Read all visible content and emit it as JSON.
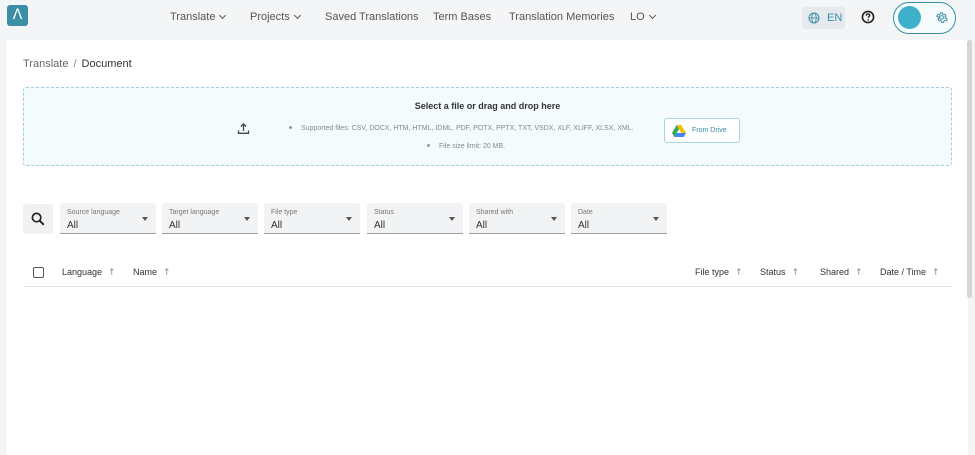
{
  "nav": {
    "logo": "Λ",
    "items": [
      {
        "label": "Translate",
        "dropdown": true
      },
      {
        "label": "Projects",
        "dropdown": true
      },
      {
        "label": "Saved Translations",
        "dropdown": false
      },
      {
        "label": "Term Bases",
        "dropdown": false
      },
      {
        "label": "Translation Memories",
        "dropdown": false
      },
      {
        "label": "LO",
        "dropdown": true
      }
    ],
    "language": "EN",
    "accent_color": "#3b8ea5"
  },
  "breadcrumb": {
    "parent": "Translate",
    "separator": "/",
    "current": "Document"
  },
  "upload": {
    "title": "Select a file or drag and drop here",
    "supported": "Supported files: CSV, DOCX, HTM, HTML, IDML, PDF, POTX, PPTX, TXT, VSDX, XLF, XLIFF, XLSX, XML.",
    "size_limit": "File size limit: 20 MB.",
    "drive_button": "From Drive"
  },
  "filters": [
    {
      "label": "Source language",
      "value": "All"
    },
    {
      "label": "Target language",
      "value": "All"
    },
    {
      "label": "File type",
      "value": "All"
    },
    {
      "label": "Status",
      "value": "All"
    },
    {
      "label": "Shared with",
      "value": "All"
    },
    {
      "label": "Date",
      "value": "All"
    }
  ],
  "table": {
    "columns": [
      "Language",
      "Name",
      "File type",
      "Status",
      "Shared",
      "Date / Time"
    ],
    "sort_arrow": "↑",
    "rows": []
  }
}
